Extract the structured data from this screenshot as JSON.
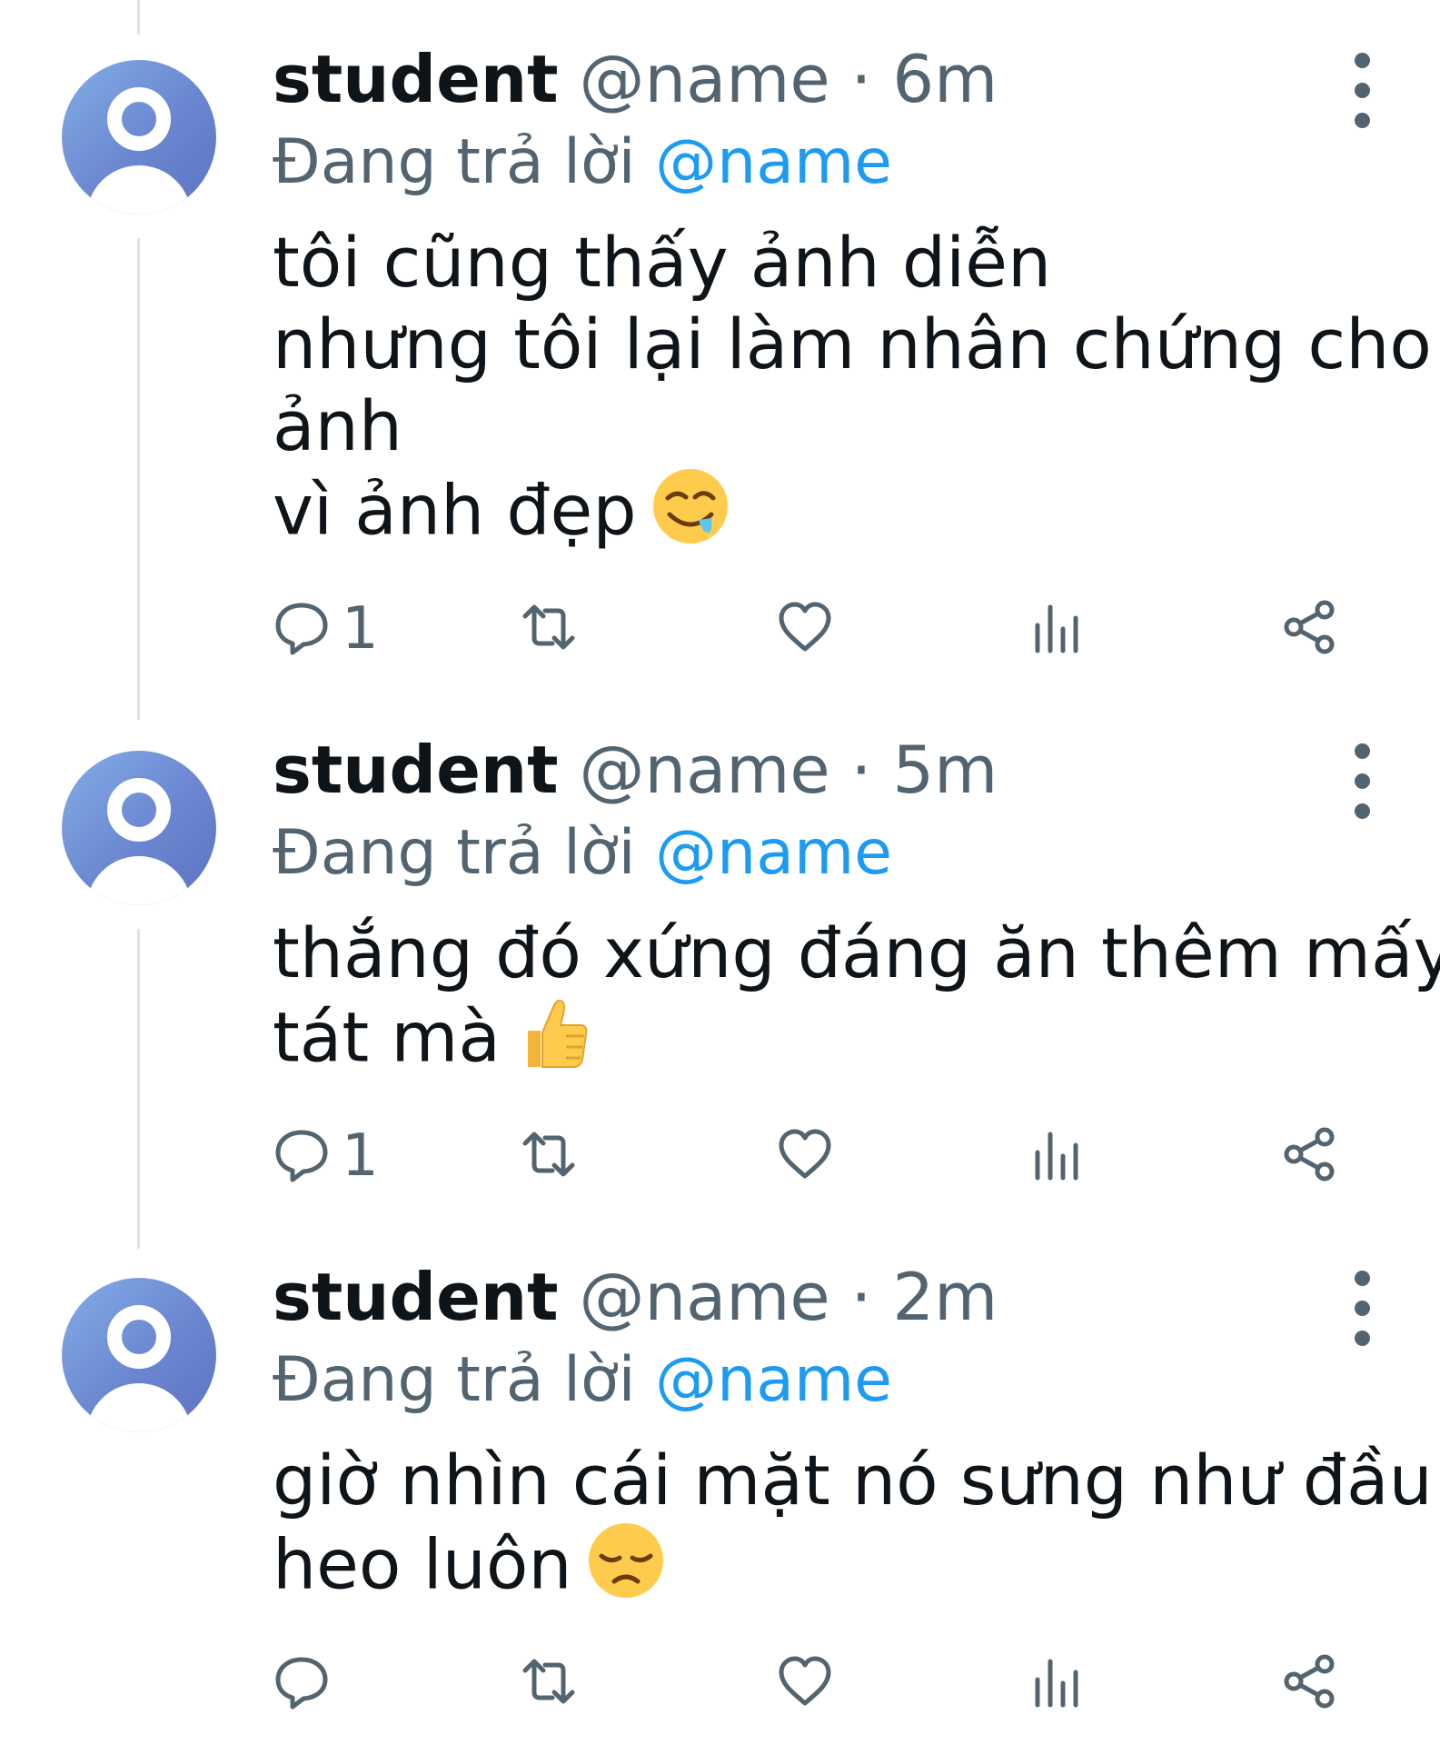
{
  "tweets": [
    {
      "author": "student",
      "handle": "@name",
      "separator": "·",
      "time": "6m",
      "replying_prefix": "Đang trả lời",
      "replying_to": "@name",
      "lines": [
        "tôi cũng thấy ảnh diễn",
        "nhưng tôi lại làm nhân chứng cho",
        "ảnh",
        "vì ảnh đẹp"
      ],
      "emoji": "drooling-face-emoji",
      "reply_count": "1"
    },
    {
      "author": "student",
      "handle": "@name",
      "separator": "·",
      "time": "5m",
      "replying_prefix": "Đang trả lời",
      "replying_to": "@name",
      "lines": [
        "thắng đó xứng đáng ăn thêm mấy",
        "tát mà"
      ],
      "emoji": "thumbs-up-emoji",
      "reply_count": "1"
    },
    {
      "author": "student",
      "handle": "@name",
      "separator": "·",
      "time": "2m",
      "replying_prefix": "Đang trả lời",
      "replying_to": "@name",
      "lines": [
        "giờ nhìn cái mặt nó sưng như đầu",
        "heo luôn"
      ],
      "emoji": "disappointed-face-emoji",
      "reply_count": ""
    }
  ],
  "icons": {
    "reply": "reply-icon",
    "retweet": "retweet-icon",
    "like": "heart-icon",
    "views": "views-icon",
    "share": "share-icon",
    "more": "more-vertical-icon"
  },
  "colors": {
    "text": "#0f1419",
    "secondary": "#536471",
    "mention": "#1d9bf0",
    "avatar": "#6b86d0",
    "thread_line": "#dde2e6"
  }
}
